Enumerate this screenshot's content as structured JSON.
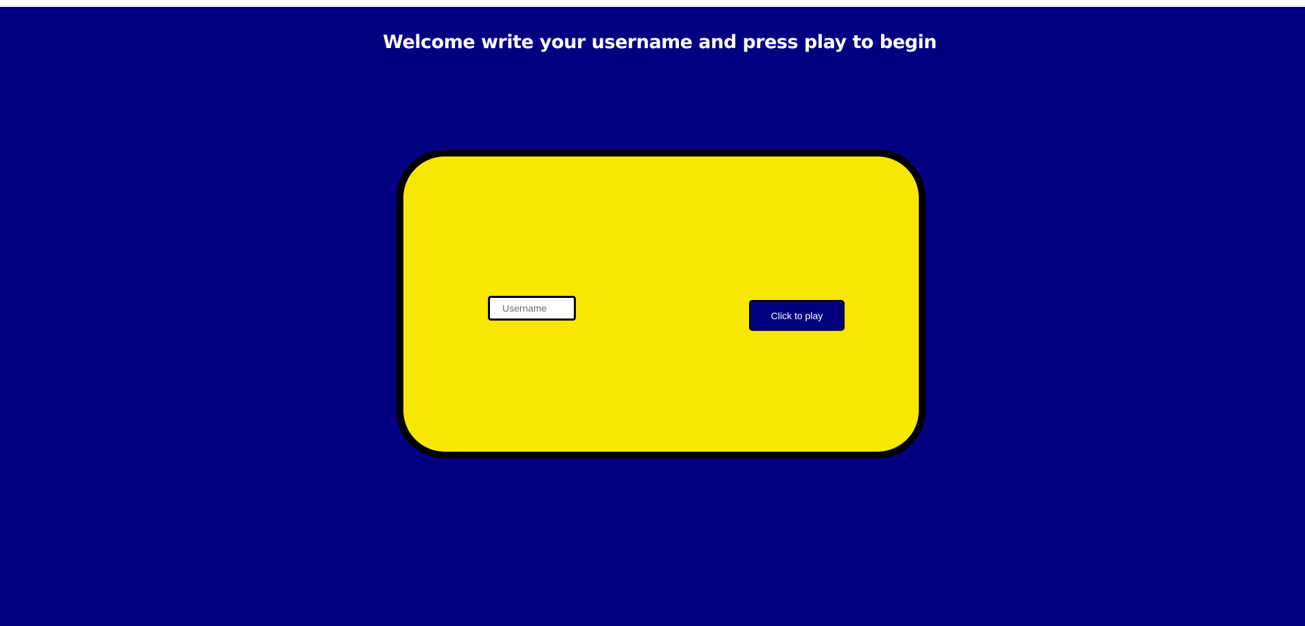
{
  "header": {
    "title": "Welcome write your username and press play to begin"
  },
  "login_card": {
    "username_input": {
      "placeholder": "Username",
      "value": ""
    },
    "play_button_label": "Click to play"
  },
  "colors": {
    "background": "#020080",
    "card": "#f7e702",
    "card_border": "#000000",
    "button": "#03007f",
    "text": "#ffffff"
  }
}
